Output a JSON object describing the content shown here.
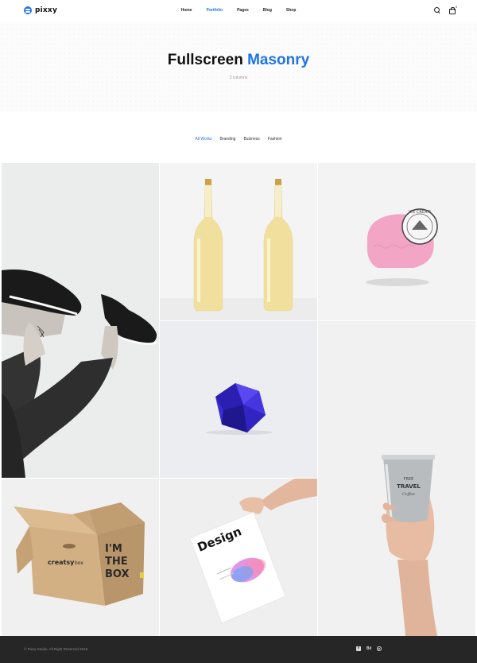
{
  "header": {
    "logo_text": "pixxy",
    "nav": [
      "Home",
      "Portfolio",
      "Pages",
      "Blog",
      "Shop"
    ],
    "active_nav": "Portfolio",
    "cart_count": "0",
    "icons": [
      "search-icon",
      "cart-icon"
    ]
  },
  "hero": {
    "title_main": "Fullscreen",
    "title_accent": "Masonry",
    "subtitle": "3 columns"
  },
  "filters": [
    "All Works",
    "Branding",
    "Business",
    "Fashion"
  ],
  "active_filter": "All Works",
  "portfolio": {
    "box_brand": "creatsy",
    "box_brand_suffix": "box",
    "box_slogan_1": "I'M",
    "box_slogan_2": "THE",
    "box_slogan_3": "BOX",
    "poster_title": "Design",
    "cup_text_1": "FREE",
    "cup_text_2": "TRAVEL",
    "cup_text_3": "Coffee",
    "stamp_text": "ICE CREAM"
  },
  "footer": {
    "copyright": "© Pixxy Studio. All Right Reserved 2018.",
    "social_icons": [
      "facebook-icon",
      "behance-icon",
      "pinterest-icon"
    ]
  },
  "colors": {
    "accent": "#1e73e8",
    "footer_bg": "#262626"
  }
}
